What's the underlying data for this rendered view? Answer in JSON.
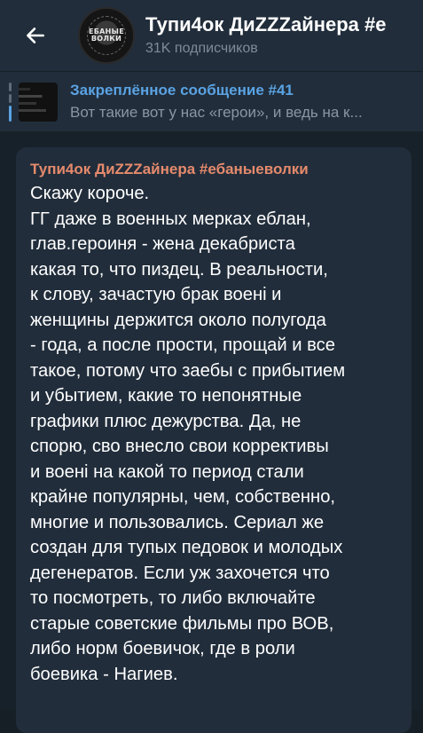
{
  "header": {
    "back_icon": "arrow-left-icon",
    "avatar_text": "ЕБАНЫЕ ВОЛКИ",
    "title": "Тупи4ок ДиZZZайнера #е",
    "subtitle": "31K подписчиков"
  },
  "pinned": {
    "title": "Закреплённое сообщение #41",
    "preview": "Вот такие вот у нас «герои», и ведь на к..."
  },
  "message": {
    "author": "Тупи4ок ДиZZZайнера #ебаныеволки",
    "lines": [
      "Скажу короче.",
      "ГГ даже в военных мерках еблан,",
      "глав.героиня - жена декабриста",
      "какая то, что пиздец. В реальности,",
      "к слову, зачастую брак военi и",
      "женщины держится около полугода",
      "- года, а после прости, прощай и все",
      "такое, потому что заебы с прибытием",
      "и убытием, какие то непонятные",
      "графики плюс дежурства.  Да, не",
      "спорю, сво внесло свои коррективы",
      "и военi на какой то период стали",
      "крайне популярны, чем, собственно,",
      "многие и пользовались. Сериал же",
      "создан для тупых педовок и молодых",
      "дегенератов. Если уж захочется что",
      "то посмотреть, то либо включайте",
      "старые советские фильмы про ВОВ,",
      "либо норм боевичок, где в роли",
      "боевика - Нагиев."
    ]
  },
  "colors": {
    "header_bg": "#212d3b",
    "chat_bg": "#172129",
    "accent_blue": "#5aa3e3",
    "author_color": "#e58a6c",
    "muted_text": "#7f8b97"
  }
}
